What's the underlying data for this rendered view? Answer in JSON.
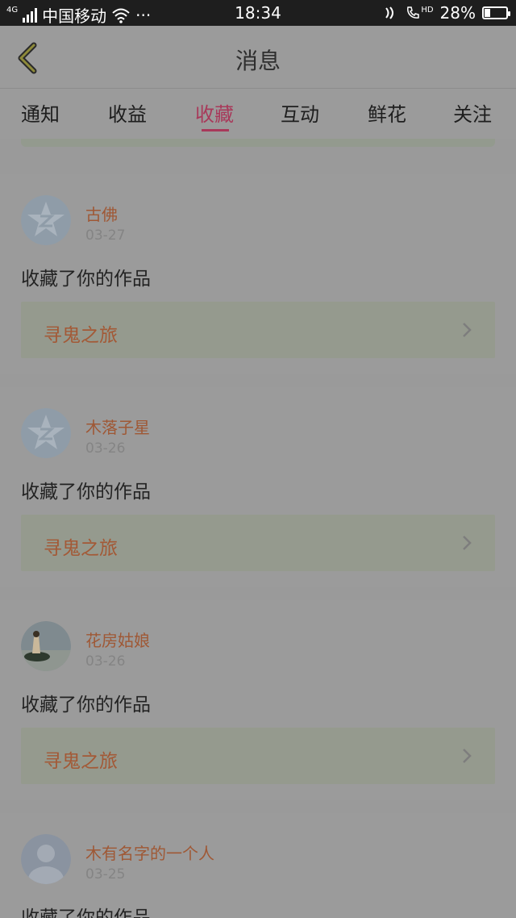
{
  "status_bar": {
    "network": "4G",
    "carrier": "中国移动",
    "more": "···",
    "time": "18:34",
    "volte": "HD",
    "battery_percent": "28%",
    "battery_level": 0.28
  },
  "header": {
    "title": "消息",
    "back_icon": "chevron-left-icon"
  },
  "tabs": [
    {
      "label": "通知",
      "active": false
    },
    {
      "label": "收益",
      "active": false
    },
    {
      "label": "收藏",
      "active": true
    },
    {
      "label": "互动",
      "active": false
    },
    {
      "label": "鲜花",
      "active": false
    },
    {
      "label": "关注",
      "active": false
    }
  ],
  "colors": {
    "accent": "#a8395a",
    "name": "#9f5835",
    "work_title": "#a35936"
  },
  "items": [
    {
      "name": "古佛",
      "date": "03-27",
      "action": "收藏了你的作品",
      "work": "寻鬼之旅",
      "avatar": "default-star-avatar"
    },
    {
      "name": "木落子星",
      "date": "03-26",
      "action": "收藏了你的作品",
      "work": "寻鬼之旅",
      "avatar": "default-star-avatar"
    },
    {
      "name": "花房姑娘",
      "date": "03-26",
      "action": "收藏了你的作品",
      "work": "寻鬼之旅",
      "avatar": "photo-avatar"
    },
    {
      "name": "木有名字的一个人",
      "date": "03-25",
      "action": "收藏了你的作品",
      "work": "",
      "avatar": "silhouette-avatar"
    }
  ]
}
